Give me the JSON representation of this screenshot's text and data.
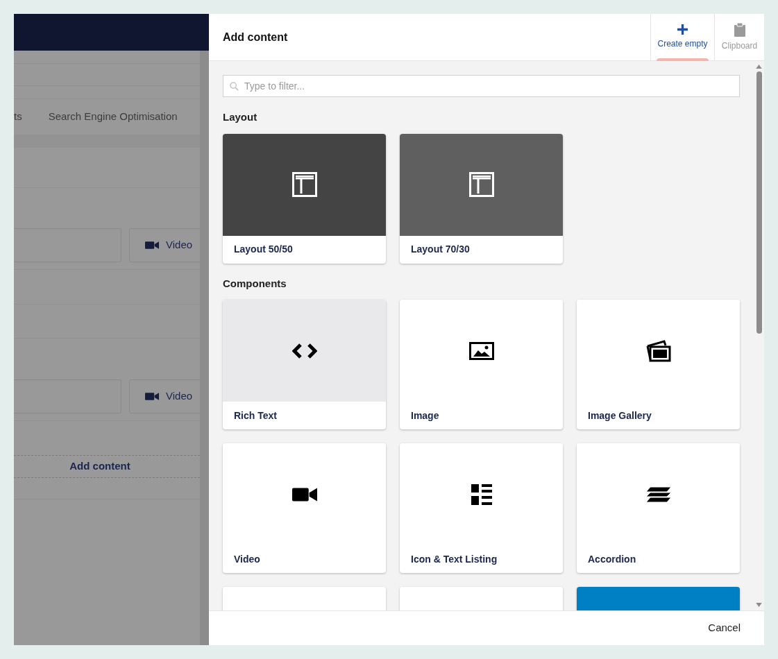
{
  "background": {
    "tabs": [
      "ts",
      "Search Engine Optimisation"
    ],
    "blocks": [
      {
        "label": "Video"
      },
      {
        "label": "Video"
      }
    ],
    "add_button": "Add content"
  },
  "panel": {
    "title": "Add content",
    "actions": [
      {
        "label": "Create empty",
        "kind": "create",
        "selected": true,
        "disabled": false
      },
      {
        "label": "Clipboard",
        "kind": "clipboard",
        "selected": false,
        "disabled": true
      }
    ],
    "filter": {
      "placeholder": "Type to filter..."
    },
    "groups": [
      {
        "title": "Layout",
        "items": [
          {
            "label": "Layout 50/50",
            "kind": "layout",
            "color": "#444444"
          },
          {
            "label": "Layout 70/30",
            "kind": "layout",
            "color": "#5f5f5f"
          }
        ]
      },
      {
        "title": "Components",
        "items": [
          {
            "label": "Rich Text",
            "kind": "code",
            "highlighted": true
          },
          {
            "label": "Image",
            "kind": "image",
            "highlighted": false
          },
          {
            "label": "Image Gallery",
            "kind": "gallery",
            "highlighted": false
          },
          {
            "label": "Video",
            "kind": "video",
            "highlighted": false
          },
          {
            "label": "Icon & Text Listing",
            "kind": "listing",
            "highlighted": false
          },
          {
            "label": "Accordion",
            "kind": "accordion",
            "highlighted": false
          },
          {
            "kind": "blank",
            "highlighted": false
          },
          {
            "kind": "blank",
            "highlighted": false
          },
          {
            "kind": "blank",
            "color": "#0080c4"
          }
        ]
      }
    ]
  },
  "footer": {
    "cancel": "Cancel"
  }
}
